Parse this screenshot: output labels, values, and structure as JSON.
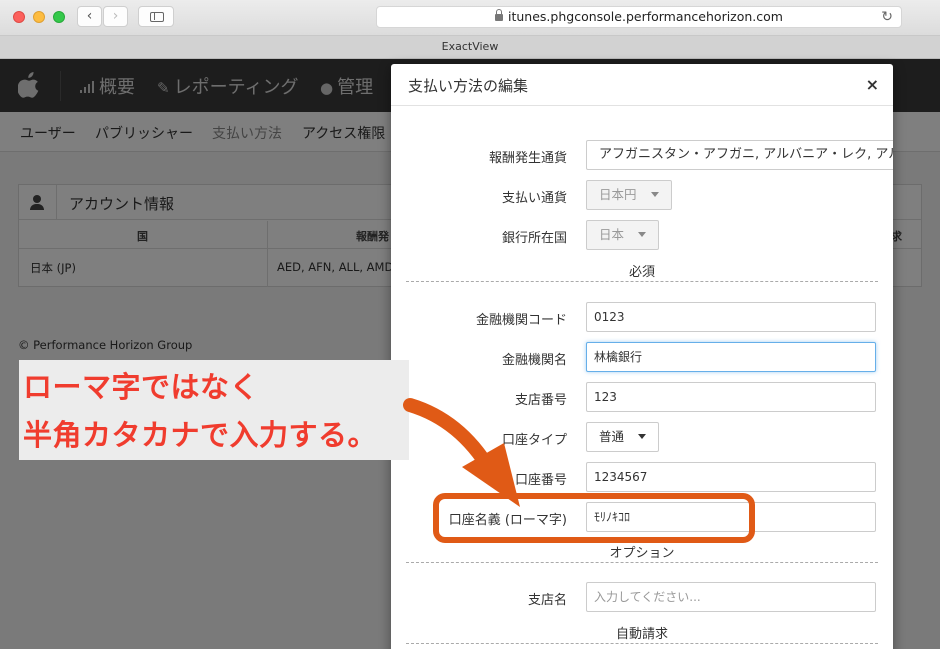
{
  "browser": {
    "url": "itunes.phgconsole.performancehorizon.com",
    "tab_title": "ExactView"
  },
  "app_nav": {
    "items": [
      {
        "label": "概要",
        "icon": "bar-chart-icon"
      },
      {
        "label": "レポーティング",
        "icon": "pencil-icon"
      },
      {
        "label": "管理",
        "icon": "user-icon"
      }
    ]
  },
  "subnav": {
    "items": [
      "ユーザー",
      "パブリッシャー",
      "支払い方法",
      "アクセス権限"
    ]
  },
  "account_panel": {
    "title": "アカウント情報",
    "columns": [
      "国",
      "報酬発",
      "求"
    ],
    "row": {
      "country": "日本 (JP)",
      "currencies": "AED, AFN, ALL, AMD,"
    }
  },
  "footer": "© Performance Horizon Group",
  "modal": {
    "title": "支払い方法の編集",
    "close": "×",
    "fields": {
      "reward_currency": {
        "label": "報酬発生通貨",
        "value": "アフガニスタン・アフガニ, アルバニア・レク, アルメ"
      },
      "payment_currency": {
        "label": "支払い通貨",
        "value": "日本円"
      },
      "bank_country": {
        "label": "銀行所在国",
        "value": "日本"
      },
      "required_section": "必須",
      "bank_code": {
        "label": "金融機関コード",
        "value": "0123"
      },
      "bank_name": {
        "label": "金融機関名",
        "value": "林檎銀行"
      },
      "branch_number": {
        "label": "支店番号",
        "value": "123"
      },
      "account_type": {
        "label": "口座タイプ",
        "value": "普通"
      },
      "account_number": {
        "label": "口座番号",
        "value": "1234567"
      },
      "account_holder": {
        "label": "口座名義 (ローマ字)",
        "value": "ﾓﾘﾉｷｺﾛ"
      },
      "option_section": "オプション",
      "branch_name": {
        "label": "支店名",
        "placeholder": "入力してください..."
      },
      "auto_billing_section": "自動請求"
    }
  },
  "annotation": {
    "line1": "ローマ字ではなく",
    "line2": "半角カタカナで入力する。",
    "color": "#f03c2e",
    "arrow_color": "#e05a16"
  }
}
